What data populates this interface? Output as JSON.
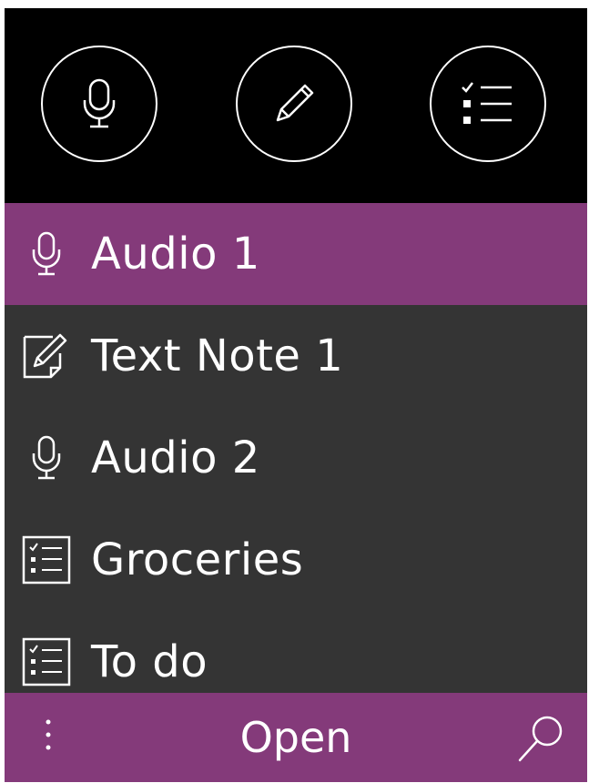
{
  "toolbar": {
    "buttons": [
      {
        "icon": "microphone-icon"
      },
      {
        "icon": "pencil-icon"
      },
      {
        "icon": "checklist-icon"
      }
    ]
  },
  "notes": {
    "items": [
      {
        "icon": "microphone-icon",
        "label": "Audio 1",
        "selected": true
      },
      {
        "icon": "text-note-icon",
        "label": "Text Note 1",
        "selected": false
      },
      {
        "icon": "microphone-icon",
        "label": "Audio 2",
        "selected": false
      },
      {
        "icon": "checklist-icon",
        "label": "Groceries",
        "selected": false
      },
      {
        "icon": "checklist-icon",
        "label": "To do",
        "selected": false
      }
    ]
  },
  "appbar": {
    "primary_label": "Open",
    "more_icon": "more-dots-icon",
    "search_icon": "search-icon"
  },
  "colors": {
    "accent": "#843a7a",
    "toolbar_bg": "#000000",
    "list_bg": "#343434",
    "text": "#ffffff"
  }
}
